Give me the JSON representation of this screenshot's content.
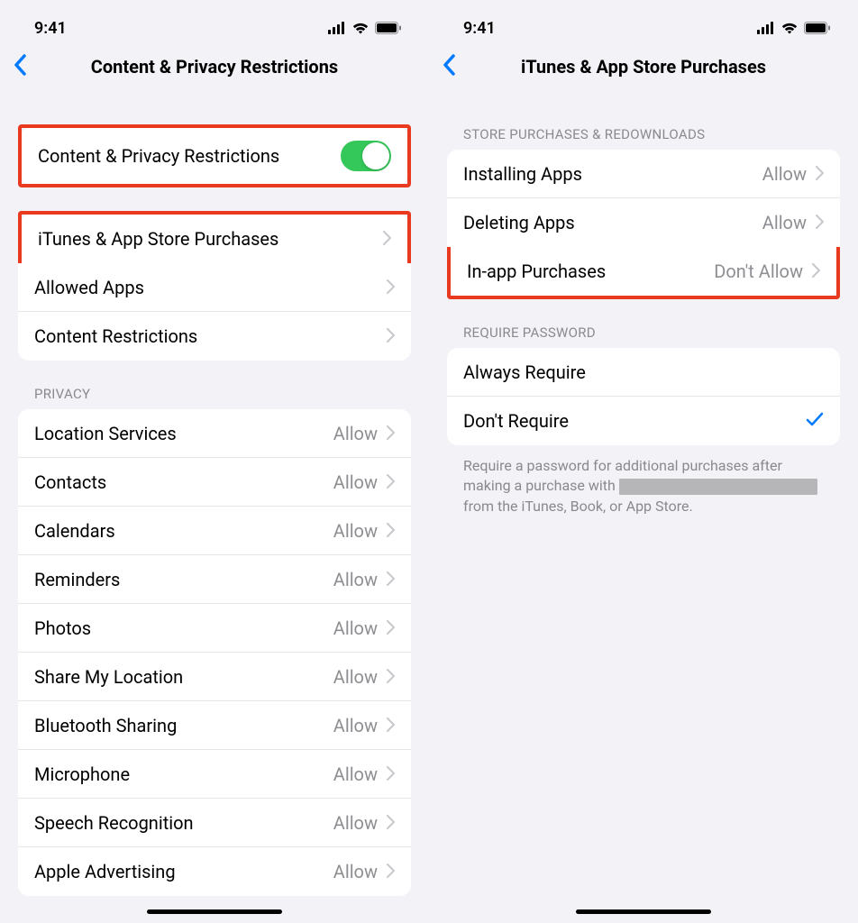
{
  "statusbar": {
    "time": "9:41"
  },
  "left": {
    "title": "Content & Privacy Restrictions",
    "toggle": {
      "label": "Content & Privacy Restrictions",
      "on": true
    },
    "main_rows": [
      {
        "label": "iTunes & App Store Purchases"
      },
      {
        "label": "Allowed Apps"
      },
      {
        "label": "Content Restrictions"
      }
    ],
    "privacy_header": "Privacy",
    "privacy_rows": [
      {
        "label": "Location Services",
        "value": "Allow"
      },
      {
        "label": "Contacts",
        "value": "Allow"
      },
      {
        "label": "Calendars",
        "value": "Allow"
      },
      {
        "label": "Reminders",
        "value": "Allow"
      },
      {
        "label": "Photos",
        "value": "Allow"
      },
      {
        "label": "Share My Location",
        "value": "Allow"
      },
      {
        "label": "Bluetooth Sharing",
        "value": "Allow"
      },
      {
        "label": "Microphone",
        "value": "Allow"
      },
      {
        "label": "Speech Recognition",
        "value": "Allow"
      },
      {
        "label": "Apple Advertising",
        "value": "Allow"
      }
    ]
  },
  "right": {
    "title": "iTunes & App Store Purchases",
    "store_header": "Store Purchases & Redownloads",
    "store_rows": [
      {
        "label": "Installing Apps",
        "value": "Allow"
      },
      {
        "label": "Deleting Apps",
        "value": "Allow"
      },
      {
        "label": "In-app Purchases",
        "value": "Don't Allow"
      }
    ],
    "password_header": "Require Password",
    "password_rows": [
      {
        "label": "Always Require",
        "checked": false
      },
      {
        "label": "Don't Require",
        "checked": true
      }
    ],
    "footer_pre": "Require a password for additional purchases after making a purchase with ",
    "footer_post": " from the iTunes, Book, or App Store."
  }
}
